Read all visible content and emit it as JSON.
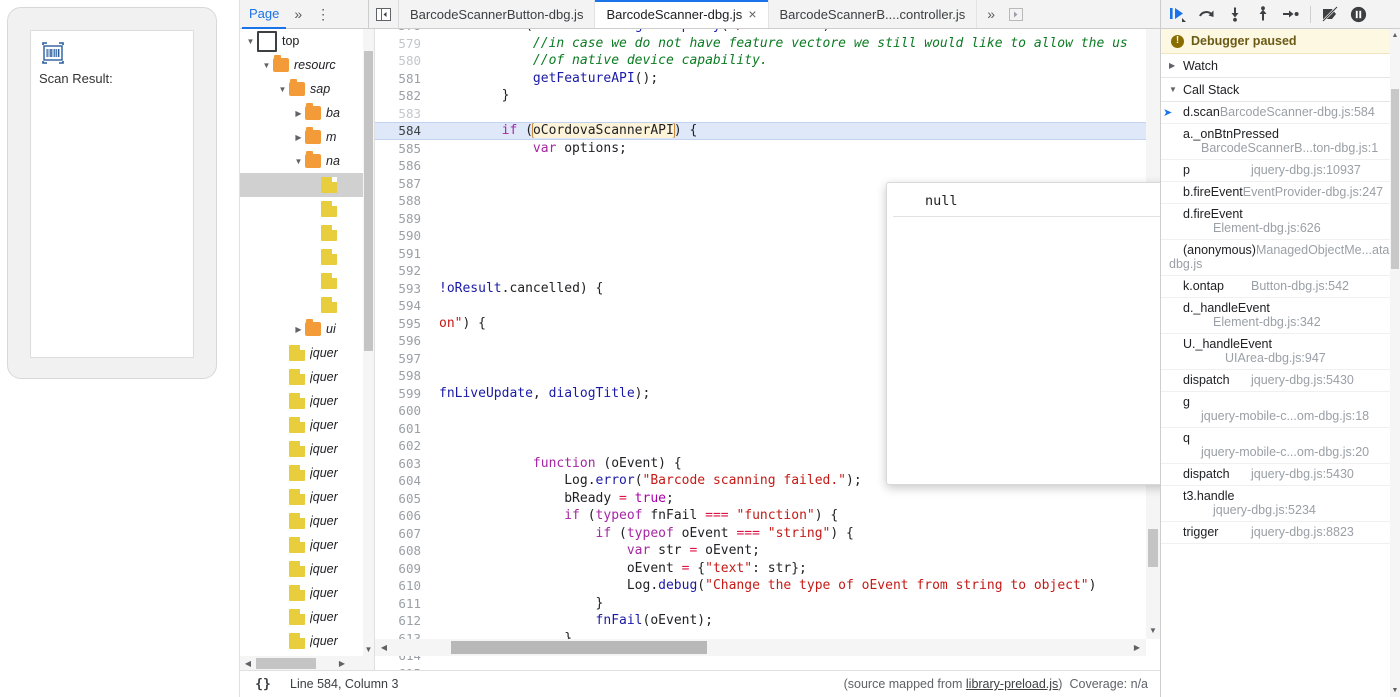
{
  "preview": {
    "icon_name": "barcode-scanner-icon",
    "label": "Scan Result:"
  },
  "topbar": {
    "nav_tab": "Page",
    "nav_more": "»",
    "nav_dots": "⋮",
    "panel_toggle_icon": "collapse-panel-icon",
    "tabs": [
      {
        "label": "BarcodeScannerButton-dbg.js",
        "active": false,
        "closable": false
      },
      {
        "label": "BarcodeScanner-dbg.js",
        "active": true,
        "closable": true,
        "close": "×"
      },
      {
        "label": "BarcodeScannerB....controller.js",
        "active": false,
        "closable": false
      }
    ],
    "tabs_more": "»",
    "tabs_right_icon": "show-more-tabs-icon"
  },
  "navigator": {
    "tree": [
      {
        "depth": 0,
        "twist": "▼",
        "icon": "frame",
        "label": "top",
        "italic": false,
        "selected": false
      },
      {
        "depth": 1,
        "twist": "▼",
        "icon": "folder",
        "label": "resourc",
        "italic": true,
        "selected": false
      },
      {
        "depth": 2,
        "twist": "▼",
        "icon": "folder",
        "label": "sap",
        "italic": true,
        "selected": false
      },
      {
        "depth": 3,
        "twist": "▶",
        "icon": "folder",
        "label": "ba",
        "italic": true,
        "selected": false
      },
      {
        "depth": 3,
        "twist": "▶",
        "icon": "folder",
        "label": "m",
        "italic": true,
        "selected": false
      },
      {
        "depth": 3,
        "twist": "▼",
        "icon": "folder",
        "label": "na",
        "italic": true,
        "selected": false
      },
      {
        "depth": 4,
        "twist": "",
        "icon": "doc",
        "label": "",
        "italic": true,
        "selected": true
      },
      {
        "depth": 4,
        "twist": "",
        "icon": "doc",
        "label": "",
        "italic": true,
        "selected": false
      },
      {
        "depth": 4,
        "twist": "",
        "icon": "doc",
        "label": "",
        "italic": true,
        "selected": false
      },
      {
        "depth": 4,
        "twist": "",
        "icon": "doc",
        "label": "",
        "italic": true,
        "selected": false
      },
      {
        "depth": 4,
        "twist": "",
        "icon": "doc",
        "label": "",
        "italic": true,
        "selected": false
      },
      {
        "depth": 4,
        "twist": "",
        "icon": "doc",
        "label": "",
        "italic": true,
        "selected": false
      },
      {
        "depth": 3,
        "twist": "▶",
        "icon": "folder",
        "label": "ui",
        "italic": true,
        "selected": false
      },
      {
        "depth": 2,
        "twist": "",
        "icon": "doc",
        "label": "jquer",
        "italic": true,
        "selected": false
      },
      {
        "depth": 2,
        "twist": "",
        "icon": "doc",
        "label": "jquer",
        "italic": true,
        "selected": false
      },
      {
        "depth": 2,
        "twist": "",
        "icon": "doc",
        "label": "jquer",
        "italic": true,
        "selected": false
      },
      {
        "depth": 2,
        "twist": "",
        "icon": "doc",
        "label": "jquer",
        "italic": true,
        "selected": false
      },
      {
        "depth": 2,
        "twist": "",
        "icon": "doc",
        "label": "jquer",
        "italic": true,
        "selected": false
      },
      {
        "depth": 2,
        "twist": "",
        "icon": "doc",
        "label": "jquer",
        "italic": true,
        "selected": false
      },
      {
        "depth": 2,
        "twist": "",
        "icon": "doc",
        "label": "jquer",
        "italic": true,
        "selected": false
      },
      {
        "depth": 2,
        "twist": "",
        "icon": "doc",
        "label": "jquer",
        "italic": true,
        "selected": false
      },
      {
        "depth": 2,
        "twist": "",
        "icon": "doc",
        "label": "jquer",
        "italic": true,
        "selected": false
      },
      {
        "depth": 2,
        "twist": "",
        "icon": "doc",
        "label": "jquer",
        "italic": true,
        "selected": false
      },
      {
        "depth": 2,
        "twist": "",
        "icon": "doc",
        "label": "jquer",
        "italic": true,
        "selected": false
      },
      {
        "depth": 2,
        "twist": "",
        "icon": "doc",
        "label": "jquer",
        "italic": true,
        "selected": false
      },
      {
        "depth": 2,
        "twist": "",
        "icon": "doc",
        "label": "jquer",
        "italic": true,
        "selected": false
      }
    ],
    "scroll_up": "▲",
    "scroll_down": "▼",
    "scroll_left": "◀",
    "scroll_right": "▶"
  },
  "code": {
    "highlight_line": 584,
    "lines": [
      {
        "n": 578,
        "dim": false,
        "clipped": true,
        "html": "        <s class='k'>if</s> (oStatusModel.<s class='id'>getProperty</s>(<s class='st'>\"/available\"</s>) <s class='op'>==</s> <s class='kw'>true</s> <s class='op'>&amp;&amp;</s> oCordovaScannerAPI <s class='op'>==</s> <s class='kw'>null</s>"
      },
      {
        "n": 579,
        "dim": true,
        "html": "            <s class='cm'>//in case we do not have feature vectore we still would like to allow the us</s>"
      },
      {
        "n": 580,
        "dim": true,
        "html": "            <s class='cm'>//of native device capability.</s>"
      },
      {
        "n": 581,
        "dim": false,
        "html": "            <s class='id'>getFeatureAPI</s>();"
      },
      {
        "n": 582,
        "dim": false,
        "html": "        }"
      },
      {
        "n": 583,
        "dim": true,
        "html": ""
      },
      {
        "n": 584,
        "dim": false,
        "hl": true,
        "html": "        <s class='k'>if</s> (<s class='hov'>oCordovaScannerAPI</s>) {"
      },
      {
        "n": 585,
        "dim": false,
        "html": "            <s class='k'>var</s> options;"
      },
      {
        "n": 586,
        "dim": false,
        "html": ""
      },
      {
        "n": 587,
        "dim": false,
        "html": ""
      },
      {
        "n": 588,
        "dim": false,
        "html": ""
      },
      {
        "n": 589,
        "dim": false,
        "html": ""
      },
      {
        "n": 590,
        "dim": false,
        "html": ""
      },
      {
        "n": 591,
        "dim": false,
        "html": ""
      },
      {
        "n": 592,
        "dim": false,
        "html": ""
      },
      {
        "n": 593,
        "dim": false,
        "clip_left": true,
        "html": "<s class='id'>!oResult</s>.cancelled) {"
      },
      {
        "n": 594,
        "dim": false,
        "html": ""
      },
      {
        "n": 595,
        "dim": false,
        "clip_left": true,
        "html": "<s class='st'>on\"</s>) {"
      },
      {
        "n": 596,
        "dim": false,
        "html": ""
      },
      {
        "n": 597,
        "dim": false,
        "html": ""
      },
      {
        "n": 598,
        "dim": false,
        "html": ""
      },
      {
        "n": 599,
        "dim": false,
        "clip_left": true,
        "html": "<s class='id'>fnLiveUpdate</s>, <s class='id'>dialogTitle</s>);"
      },
      {
        "n": 600,
        "dim": false,
        "html": ""
      },
      {
        "n": 601,
        "dim": false,
        "html": ""
      },
      {
        "n": 602,
        "dim": false,
        "html": ""
      },
      {
        "n": 603,
        "dim": false,
        "html": "            <s class='k'>function</s> (oEvent) {"
      },
      {
        "n": 604,
        "dim": false,
        "html": "                Log.<s class='id'>error</s>(<s class='st'>\"Barcode scanning failed.\"</s>);"
      },
      {
        "n": 605,
        "dim": false,
        "html": "                bReady <s class='op'>=</s> <s class='kw'>true</s>;"
      },
      {
        "n": 606,
        "dim": false,
        "html": "                <s class='k'>if</s> (<s class='k'>typeof</s> fnFail <s class='op'>===</s> <s class='st'>\"function\"</s>) {"
      },
      {
        "n": 607,
        "dim": false,
        "html": "                    <s class='k'>if</s> (<s class='k'>typeof</s> oEvent <s class='op'>===</s> <s class='st'>\"string\"</s>) {"
      },
      {
        "n": 608,
        "dim": false,
        "html": "                        <s class='k'>var</s> str <s class='op'>=</s> oEvent;"
      },
      {
        "n": 609,
        "dim": false,
        "html": "                        oEvent <s class='op'>=</s> {<s class='st'>\"text\"</s>: str};"
      },
      {
        "n": 610,
        "dim": false,
        "html": "                        Log.<s class='id'>debug</s>(<s class='st'>\"Change the type of oEvent from string to object\"</s>)"
      },
      {
        "n": 611,
        "dim": false,
        "html": "                    }"
      },
      {
        "n": 612,
        "dim": false,
        "html": "                    <s class='id'>fnFail</s>(oEvent);"
      },
      {
        "n": 613,
        "dim": false,
        "html": "                }"
      },
      {
        "n": 614,
        "dim": false,
        "html": ""
      },
      {
        "n": 615,
        "dim": false,
        "clipped": true,
        "html": ""
      }
    ],
    "tooltip": {
      "value": "null"
    },
    "scroll_up": "▲",
    "scroll_down": "▼",
    "scroll_left": "◀",
    "scroll_right": "▶"
  },
  "statusbar": {
    "braces": "{}",
    "position": "Line 584, Column 3",
    "source_map_prefix": "(source mapped from",
    "source_map_link": "library-preload.js",
    "source_map_suffix": ")",
    "coverage": "Coverage: n/a"
  },
  "debugger": {
    "toolbar": [
      {
        "name": "resume-script-execution-button",
        "icon": "resume-icon",
        "accent": "#1a73e8"
      },
      {
        "name": "step-over-button",
        "icon": "step-over-icon",
        "accent": "#5f6368"
      },
      {
        "name": "step-into-button",
        "icon": "step-into-icon",
        "accent": "#5f6368"
      },
      {
        "name": "step-out-button",
        "icon": "step-out-icon",
        "accent": "#5f6368"
      },
      {
        "name": "step-button",
        "icon": "step-icon",
        "accent": "#5f6368"
      },
      {
        "name": "deactivate-breakpoints-button",
        "icon": "deactivate-breakpoints-icon",
        "accent": "#5f6368"
      },
      {
        "name": "pause-on-exceptions-button",
        "icon": "pause-on-exceptions-icon",
        "accent": "#3c4043"
      }
    ],
    "paused_banner": {
      "icon": "!",
      "text": "Debugger paused"
    },
    "watch": {
      "twist": "▶",
      "title": "Watch"
    },
    "call_stack": {
      "twist": "▼",
      "title": "Call Stack"
    },
    "frames": [
      {
        "fn": "d.scan",
        "loc": "BarcodeScanner-dbg.js:584",
        "selected": true,
        "layout": "stack",
        "indent": 1
      },
      {
        "fn": "a._onBtnPressed",
        "loc": "BarcodeScannerB...ton-dbg.js:1",
        "selected": false,
        "layout": "stack",
        "indent": 0
      },
      {
        "fn": "p",
        "loc": "jquery-dbg.js:10937",
        "selected": false,
        "layout": "flat"
      },
      {
        "fn": "b.fireEvent",
        "loc": "EventProvider-dbg.js:247",
        "selected": false,
        "layout": "stack",
        "indent": 1
      },
      {
        "fn": "d.fireEvent",
        "loc": "Element-dbg.js:626",
        "selected": false,
        "layout": "stack",
        "indent": 2
      },
      {
        "fn": "(anonymous)",
        "loc": "ManagedObjectMe...ata-dbg.js",
        "selected": false,
        "layout": "stack",
        "indent": 1
      },
      {
        "fn": "k.ontap",
        "loc": "Button-dbg.js:542",
        "selected": false,
        "layout": "flat"
      },
      {
        "fn": "d._handleEvent",
        "loc": "Element-dbg.js:342",
        "selected": false,
        "layout": "stack",
        "indent": 2
      },
      {
        "fn": "U._handleEvent",
        "loc": "UIArea-dbg.js:947",
        "selected": false,
        "layout": "stack",
        "indent": 3
      },
      {
        "fn": "dispatch",
        "loc": "jquery-dbg.js:5430",
        "selected": false,
        "layout": "flat"
      },
      {
        "fn": "g",
        "loc": "jquery-mobile-c...om-dbg.js:18",
        "selected": false,
        "layout": "stack",
        "indent": 0
      },
      {
        "fn": "q",
        "loc": "jquery-mobile-c...om-dbg.js:20",
        "selected": false,
        "layout": "stack",
        "indent": 0
      },
      {
        "fn": "dispatch",
        "loc": "jquery-dbg.js:5430",
        "selected": false,
        "layout": "flat"
      },
      {
        "fn": "t3.handle",
        "loc": "jquery-dbg.js:5234",
        "selected": false,
        "layout": "stack",
        "indent": 2
      },
      {
        "fn": "trigger",
        "loc": "jquery-dbg.js:8823",
        "selected": false,
        "layout": "flat"
      }
    ],
    "scroll_up": "▲",
    "scroll_down": "▼"
  }
}
